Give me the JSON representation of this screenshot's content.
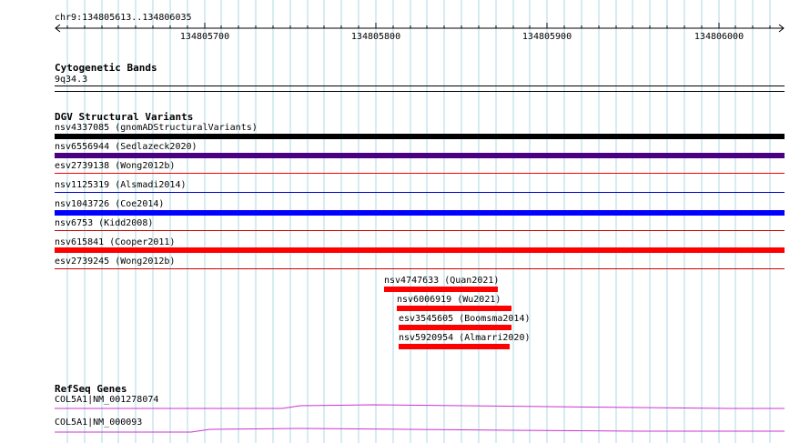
{
  "coords": {
    "location": "chr9:134805613..134806035"
  },
  "ruler": {
    "ticks": [
      "134805700",
      "134805800",
      "134805900",
      "134806000"
    ]
  },
  "cyto": {
    "title": "Cytogenetic Bands",
    "band": "9q34.3"
  },
  "dgv": {
    "title": "DGV Structural Variants",
    "variants": [
      {
        "label": "nsv4337085 (gnomADStructuralVariants)",
        "color": "#000000"
      },
      {
        "label": "nsv6556944 (Sedlazeck2020)",
        "color": "#4b0082"
      },
      {
        "label": "esv2739138 (Wong2012b)",
        "color": "#ff0000"
      },
      {
        "label": "nsv1125319 (Alsmadi2014)",
        "color": "#0000cc"
      },
      {
        "label": "nsv1043726 (Coe2014)",
        "color": "#0000ff"
      },
      {
        "label": "nsv6753 (Kidd2008)",
        "color": "#cc0000"
      },
      {
        "label": "nsv615841 (Cooper2011)",
        "color": "#ff0000"
      },
      {
        "label": "esv2739245 (Wong2012b)",
        "color": "#cc0000"
      }
    ],
    "small_variants": [
      {
        "label": "nsv4747633 (Quan2021)",
        "color": "#ff0000"
      },
      {
        "label": "nsv6006919 (Wu2021)",
        "color": "#ff0000"
      },
      {
        "label": "esv3545605 (Boomsma2014)",
        "color": "#ff0000"
      },
      {
        "label": "nsv5920954 (Almarri2020)",
        "color": "#ff0000"
      }
    ]
  },
  "refseq": {
    "title": "RefSeq Genes",
    "genes": [
      {
        "label": "COL5A1|NM_001278074",
        "color": "#cc33cc"
      },
      {
        "label": "COL5A1|NM_000093",
        "color": "#cc33cc"
      }
    ]
  },
  "colors": {
    "grid": "#add8e6",
    "ruler": "#000000"
  },
  "icons": [
    "ruler-arrow-left-icon",
    "ruler-arrow-right-icon"
  ]
}
